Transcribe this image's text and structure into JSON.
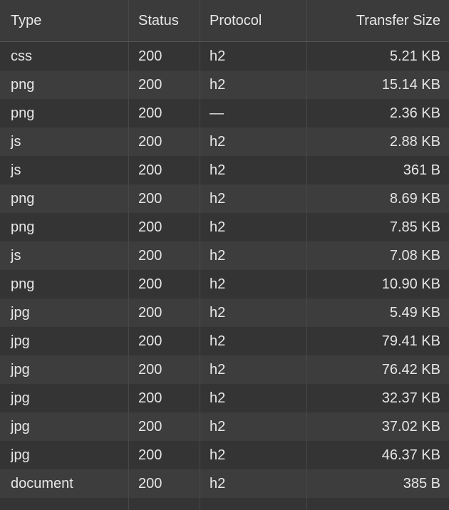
{
  "table": {
    "columns": [
      "Type",
      "Status",
      "Protocol",
      "Transfer Size"
    ],
    "rows": [
      {
        "type": "css",
        "status": "200",
        "protocol": "h2",
        "size": "5.21 KB"
      },
      {
        "type": "png",
        "status": "200",
        "protocol": "h2",
        "size": "15.14 KB"
      },
      {
        "type": "png",
        "status": "200",
        "protocol": "—",
        "size": "2.36 KB"
      },
      {
        "type": "js",
        "status": "200",
        "protocol": "h2",
        "size": "2.88 KB"
      },
      {
        "type": "js",
        "status": "200",
        "protocol": "h2",
        "size": "361 B"
      },
      {
        "type": "png",
        "status": "200",
        "protocol": "h2",
        "size": "8.69 KB"
      },
      {
        "type": "png",
        "status": "200",
        "protocol": "h2",
        "size": "7.85 KB"
      },
      {
        "type": "js",
        "status": "200",
        "protocol": "h2",
        "size": "7.08 KB"
      },
      {
        "type": "png",
        "status": "200",
        "protocol": "h2",
        "size": "10.90 KB"
      },
      {
        "type": "jpg",
        "status": "200",
        "protocol": "h2",
        "size": "5.49 KB"
      },
      {
        "type": "jpg",
        "status": "200",
        "protocol": "h2",
        "size": "79.41 KB"
      },
      {
        "type": "jpg",
        "status": "200",
        "protocol": "h2",
        "size": "76.42 KB"
      },
      {
        "type": "jpg",
        "status": "200",
        "protocol": "h2",
        "size": "32.37 KB"
      },
      {
        "type": "jpg",
        "status": "200",
        "protocol": "h2",
        "size": "37.02 KB"
      },
      {
        "type": "jpg",
        "status": "200",
        "protocol": "h2",
        "size": "46.37 KB"
      },
      {
        "type": "document",
        "status": "200",
        "protocol": "h2",
        "size": "385 B"
      }
    ]
  }
}
